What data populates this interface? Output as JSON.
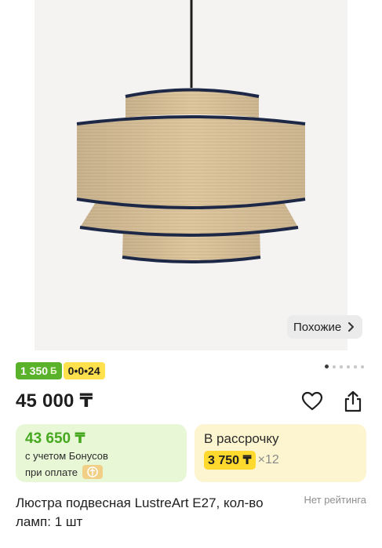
{
  "product_image": {
    "alt": "Люстра подвесная LustreArt E27"
  },
  "similar_button": {
    "label": "Похожие",
    "icon": "chevron-right-icon"
  },
  "badges": {
    "bonus": "1 350",
    "bonus_icon": "Б",
    "installment": "0•0•24"
  },
  "gallery": {
    "total": 6,
    "active_index": 0
  },
  "price": "45 000 ₸",
  "actions": {
    "favorite_icon": "heart-outline-icon",
    "share_icon": "share-icon"
  },
  "bonus_card": {
    "price": "43 650 ₸",
    "line1": "с учетом Бонусов",
    "line2": "при оплате"
  },
  "installment_card": {
    "label": "В рассрочку",
    "amount": "3 750 ₸",
    "multiplier": "×12"
  },
  "product": {
    "title": "Люстра подвесная LustreArt E27, кол-во ламп: 1 шт",
    "rating": "Нет рейтинга"
  },
  "colors": {
    "bonus_green": "#59b229",
    "installment_yellow": "#ffe04d",
    "bonus_card_bg": "#e8f8d7",
    "installment_card_bg": "#fdf5cf"
  }
}
